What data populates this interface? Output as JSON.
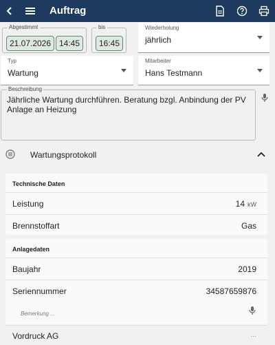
{
  "appbar": {
    "title": "Auftrag",
    "icons": [
      "chevron-left-icon",
      "menu-icon",
      "document-icon",
      "help-icon",
      "print-icon"
    ],
    "color": "#1e3a5f"
  },
  "agreed": {
    "label": "Abgestimmt",
    "date": "21.07.2026",
    "time": "14:45"
  },
  "until": {
    "label": "bis",
    "time": "16:45"
  },
  "repeat": {
    "label": "Wiederholung",
    "value": "jährlich"
  },
  "type": {
    "label": "Typ",
    "value": "Wartung"
  },
  "employee": {
    "label": "Mitarbeiter",
    "value": "Hans Testmann"
  },
  "description": {
    "label": "Beschreibung",
    "text": "Jährliche Wartung durchführen. Beratung bzgl. Anbindung der PV Anlage an Heizung"
  },
  "protocol": {
    "label": "Wartungsprotokoll"
  },
  "technical": {
    "title": "Technische Daten",
    "rows": [
      {
        "key": "Leistung",
        "value": "14",
        "unit": "kW"
      },
      {
        "key": "Brennstoffart",
        "value": "Gas",
        "unit": ""
      }
    ]
  },
  "system": {
    "title": "Anlagedaten",
    "rows": [
      {
        "key": "Baujahr",
        "value": "2019"
      },
      {
        "key": "Seriennummer",
        "value": "34587659876"
      }
    ],
    "note_placeholder": "Bemerkung ..."
  },
  "footer_item": {
    "label": "Vordruck AG",
    "more": "..."
  }
}
